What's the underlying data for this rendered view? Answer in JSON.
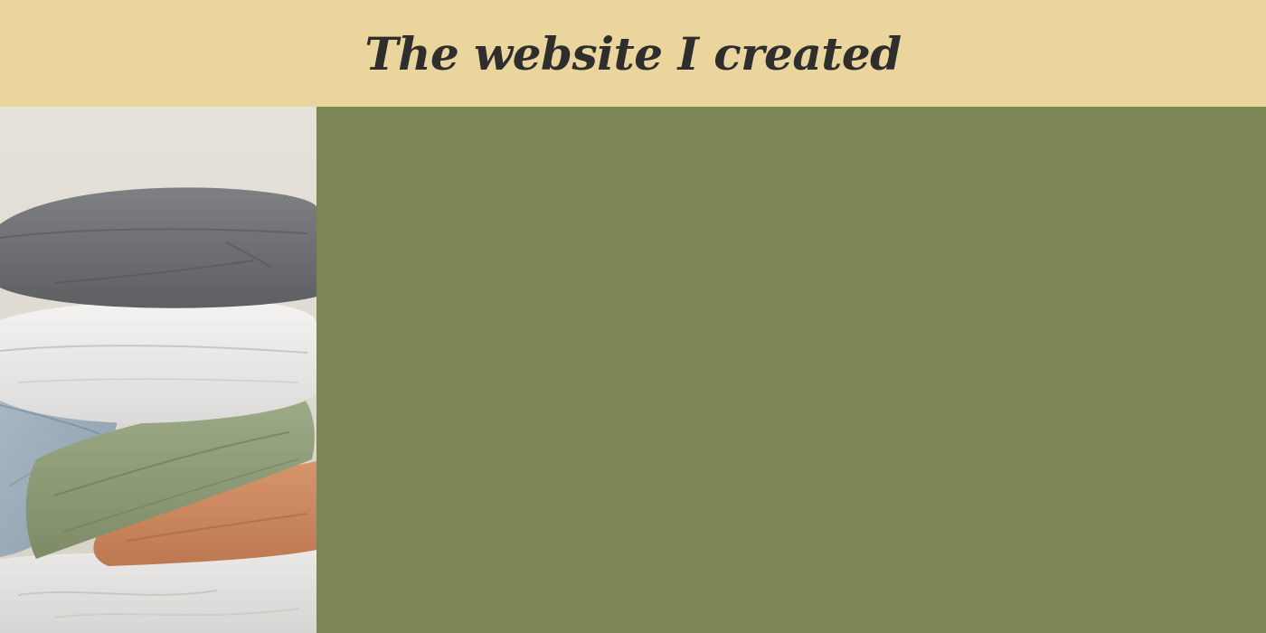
{
  "header": {
    "title": "The website I created"
  },
  "colors": {
    "header_bg": "#ead59c",
    "main_bg": "#7c8655",
    "title_text": "#2e2e2e"
  },
  "image": {
    "subject": "pillow-stack-photo"
  }
}
